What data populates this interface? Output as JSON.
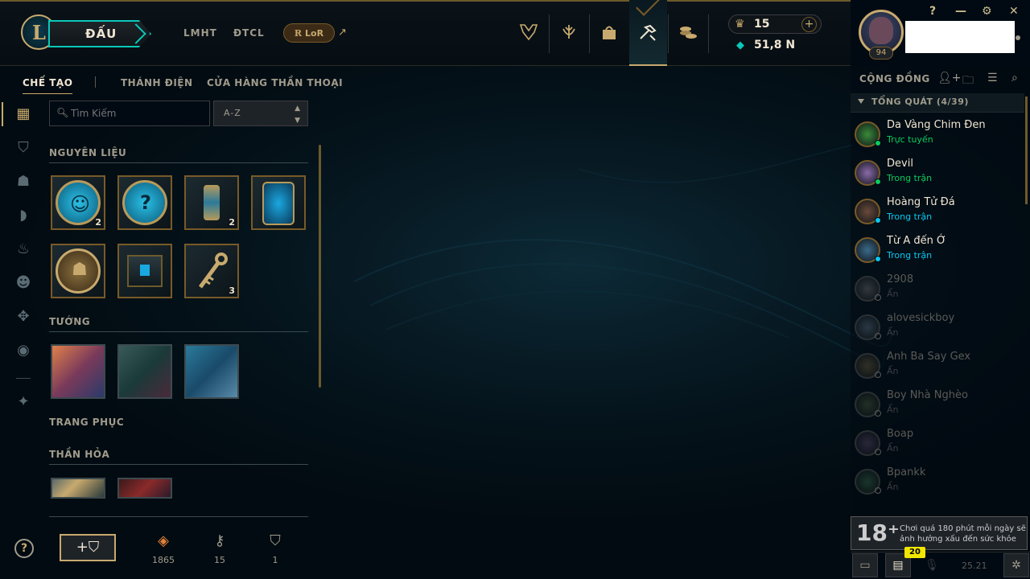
{
  "header": {
    "play_label": "ĐẤU",
    "nav": [
      "LMHT",
      "ĐTCL"
    ],
    "lor_label": "LoR",
    "wallet": {
      "rp": "15",
      "be": "51,8 N"
    },
    "level": "94",
    "window_controls": [
      "?",
      "—",
      "⚙",
      "✕"
    ]
  },
  "subnav": {
    "craft": "CHẾ TẠO",
    "sanctum": "THÁNH ĐIỆN",
    "mythic": "CỬA HÀNG THẦN THOẠI"
  },
  "search": {
    "placeholder": "Tìm Kiếm",
    "sort": "A-Z"
  },
  "sections": {
    "materials": "NGUYÊN LIỆU",
    "champions": "TƯỚNG",
    "skins": "TRANG PHỤC",
    "eternals": "THẦN HỎA"
  },
  "materials": [
    {
      "icon": "emote-orb",
      "count": "2"
    },
    {
      "icon": "mystery-orb",
      "count": ""
    },
    {
      "icon": "capsule",
      "count": "2"
    },
    {
      "icon": "hextech-hourglass",
      "count": ""
    },
    {
      "icon": "champion-orb",
      "count": ""
    },
    {
      "icon": "hextech-chest",
      "count": ""
    },
    {
      "icon": "key",
      "count": "3"
    }
  ],
  "footer": {
    "essence": "1865",
    "keys": "15",
    "chests": "1"
  },
  "social": {
    "title": "CỘNG ĐỒNG",
    "group": "TỔNG QUÁT (4/39)",
    "friends": [
      {
        "name": "Da Vàng Chim Đen",
        "status": "Trực tuyến",
        "state": "online"
      },
      {
        "name": "Devil",
        "status": "Trong trận",
        "state": "ingame"
      },
      {
        "name": "Hoàng Tử Đá",
        "status": "Trong trận",
        "state": "ingame2"
      },
      {
        "name": "Từ A đến Ớ",
        "status": "Trong trận",
        "state": "ingame2"
      },
      {
        "name": "2908",
        "status": "Ẩn",
        "state": "off"
      },
      {
        "name": "alovesickboy",
        "status": "Ẩn",
        "state": "off"
      },
      {
        "name": "Anh Ba Say Gex",
        "status": "Ẩn",
        "state": "off"
      },
      {
        "name": "Boy Nhà Nghèo",
        "status": "Ẩn",
        "state": "off"
      },
      {
        "name": "Boap",
        "status": "Ẩn",
        "state": "off"
      },
      {
        "name": "Bpankk",
        "status": "Ẩn",
        "state": "off"
      }
    ]
  },
  "warning": {
    "age": "18⁺",
    "message": "Chơi quá 180 phút mỗi ngày sẽ ảnh hưởng xấu đến sức khỏe"
  },
  "statusbar": {
    "badge": "20",
    "version": "25.21"
  },
  "colors": {
    "gold": "#c8aa6e",
    "teal": "#0ac8b9",
    "online": "#0acc5e",
    "ingame": "#0acc5e",
    "ingame2": "#0ac8f0"
  }
}
